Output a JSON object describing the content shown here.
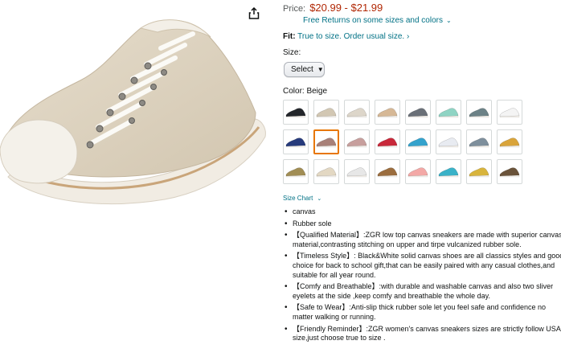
{
  "product_image": {
    "share_icon": "share-icon"
  },
  "price": {
    "label": "Price:",
    "value": "$20.99 - $21.99"
  },
  "returns": {
    "text": "Free Returns on some sizes and colors",
    "icon": "chevron-down-icon"
  },
  "fit": {
    "label": "Fit:",
    "value": "True to size. Order usual size. ›"
  },
  "size": {
    "label": "Size:",
    "select_value": "Select"
  },
  "color": {
    "label": "Color: Beige",
    "selected_index": 9,
    "swatches": [
      "#23262b",
      "#d2c7b3",
      "#ddd6ca",
      "#d6b896",
      "#6a7078",
      "#8fd4c4",
      "#6c8287",
      "#f4f4f4",
      "#273b7c",
      "#a88078",
      "#c79f9d",
      "#c8283a",
      "#34a2cc",
      "#e8ebf1",
      "#7e8f9c",
      "#d9a43a",
      "#a18d54",
      "#e3d8c3",
      "#e7e7e7",
      "#9b6d3e",
      "#f3a8a6",
      "#3ab2c8",
      "#d8b43c",
      "#6a533a"
    ]
  },
  "size_chart": {
    "label": "Size Chart",
    "icon": "chevron-down-icon"
  },
  "bullets": [
    "canvas",
    "Rubber sole",
    "【Qualified Material】:ZGR low top canvas sneakers are made with superior canvas material,contrasting stitching on upper and tirpe vulcanized rubber sole.",
    "【Timeless Style】: Black&White solid canvas shoes are all classics styles and good choice for back to school gift,that can be easily paired with any casual clothes,and suitable for all year round.",
    "【Comfy and Breathable】:with durable and washable canvas and also two sliver eyelets at the side ,keep comfy and breathable the whole day.",
    "【Safe to Wear】:Anti-slip thick rubber sole let you feel safe and confidence no matter walking or running.",
    "【Friendly Reminder】:ZGR women's canvas sneakers sizes are strictly follow USA size,just choose true to size ."
  ]
}
